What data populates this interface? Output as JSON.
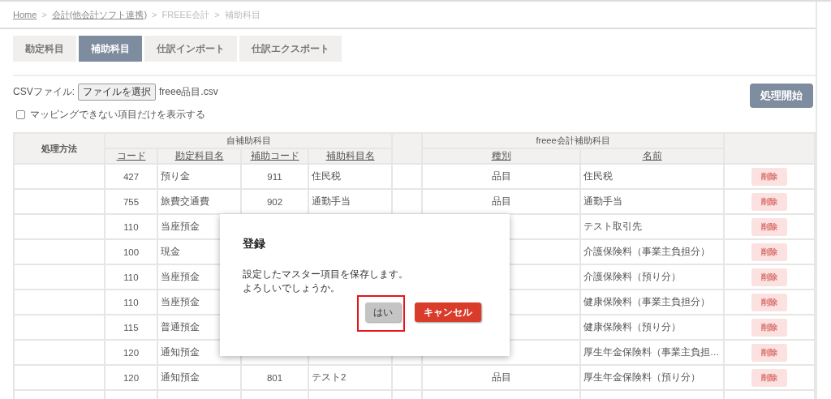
{
  "breadcrumb": [
    {
      "label": "Home",
      "link": true
    },
    {
      "label": "会計(他会計ソフト連携)",
      "link": true
    },
    {
      "label": "FREEE会計",
      "link": false
    },
    {
      "label": "補助科目",
      "link": false
    }
  ],
  "breadcrumb_separator": ">",
  "tabs": [
    {
      "label": "勘定科目",
      "selected": false
    },
    {
      "label": "補助科目",
      "selected": true
    },
    {
      "label": "仕訳インポート",
      "selected": false
    },
    {
      "label": "仕訳エクスポート",
      "selected": false
    }
  ],
  "csv": {
    "label": "CSVファイル:",
    "button": "ファイルを選択",
    "file_name": "freee品目.csv"
  },
  "start_button": "処理開始",
  "filter_checkbox": {
    "label": "マッピングできない項目だけを表示する",
    "checked": false
  },
  "table": {
    "method_header": "処理方法",
    "own_group": "自補助科目",
    "freee_group": "freee会計補助科目",
    "columns": [
      "コード",
      "勘定科目名",
      "補助コード",
      "補助科目名",
      "種別",
      "名前"
    ],
    "rows": [
      {
        "code": "427",
        "account": "預り金",
        "sub_code": "911",
        "sub_name": "住民税",
        "kind": "品目",
        "name": "住民税",
        "delete": "削除",
        "delete_disabled": true
      },
      {
        "code": "755",
        "account": "旅費交通費",
        "sub_code": "902",
        "sub_name": "通勤手当",
        "kind": "品目",
        "name": "通勤手当",
        "delete": "削除",
        "delete_disabled": true
      },
      {
        "code": "110",
        "account": "当座預金",
        "name": "テスト取引先",
        "delete": "削除",
        "delete_disabled": true
      },
      {
        "code": "100",
        "account": "現金",
        "name": "介護保険料（事業主負担分）",
        "delete": "削除",
        "delete_disabled": true
      },
      {
        "code": "110",
        "account": "当座預金",
        "name": "介護保険料（預り分）",
        "delete": "削除",
        "delete_disabled": true
      },
      {
        "code": "110",
        "account": "当座預金",
        "name": "健康保険料（事業主負担分）",
        "delete": "削除",
        "delete_disabled": true
      },
      {
        "code": "115",
        "account": "普通預金",
        "name": "健康保険料（預り分）",
        "delete": "削除",
        "delete_disabled": true
      },
      {
        "code": "120",
        "account": "通知預金",
        "name": "厚生年金保険料（事業主負担…",
        "delete": "削除",
        "delete_disabled": true
      },
      {
        "code": "120",
        "account": "通知預金",
        "sub_code": "801",
        "sub_name": "テスト2",
        "kind": "品目",
        "name": "厚生年金保険料（預り分）",
        "delete": "削除",
        "delete_disabled": true
      },
      {}
    ]
  },
  "dialog": {
    "title": "登録",
    "message": [
      "設定したマスター項目を保存します。",
      "よろしいでしょうか。"
    ],
    "buttons": [
      {
        "label": "はい",
        "kind": "secondary",
        "highlighted": true
      },
      {
        "label": "キャンセル",
        "kind": "danger",
        "highlighted": false
      }
    ]
  }
}
